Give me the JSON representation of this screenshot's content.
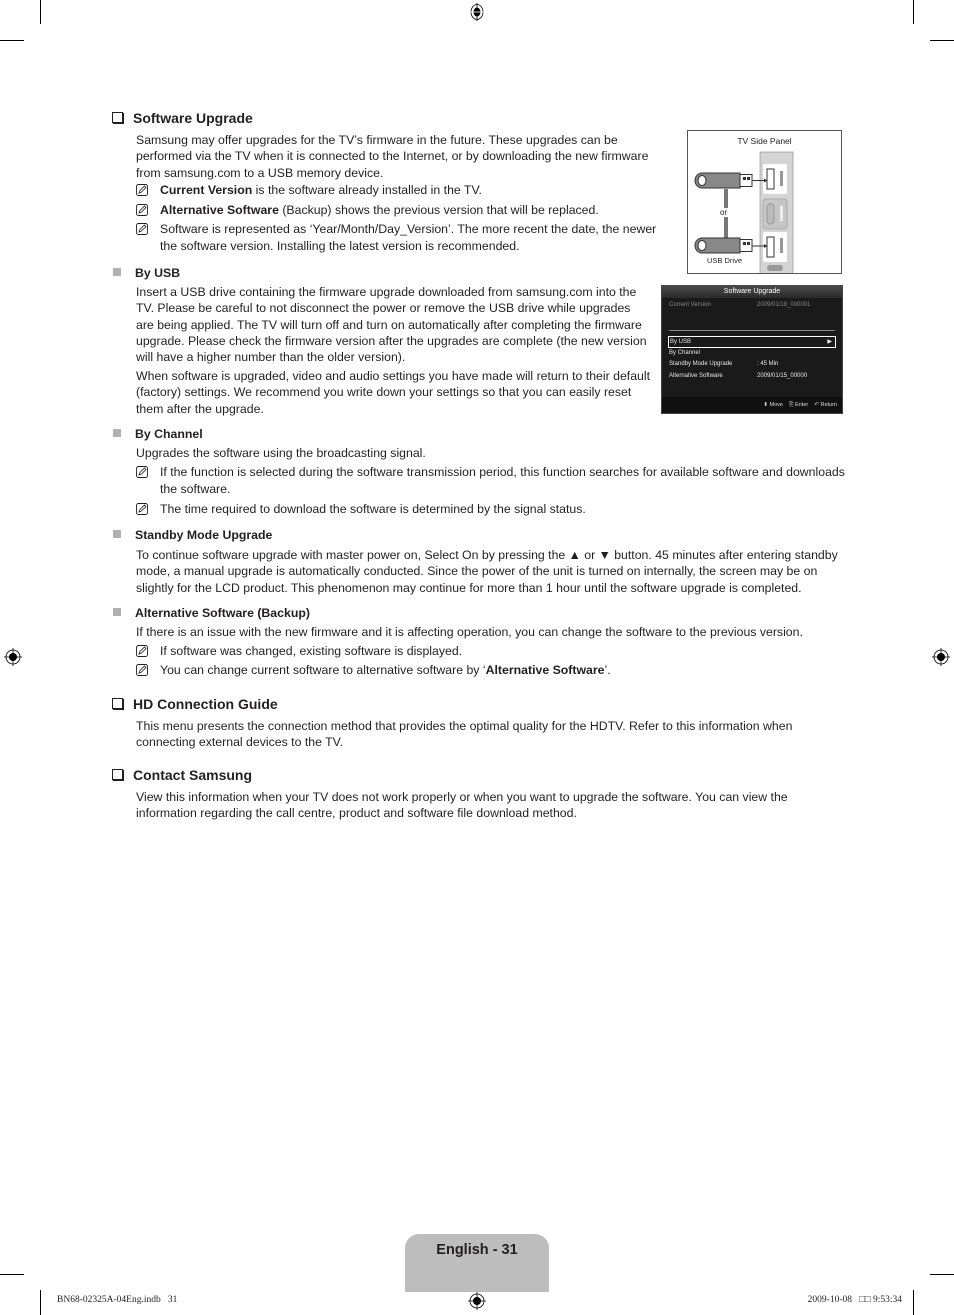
{
  "sections": {
    "software_upgrade": {
      "title": "Software Upgrade",
      "intro": "Samsung may offer upgrades for the TV’s firmware in the future. These upgrades can be performed via the TV when it is connected to the Internet, or by downloading the new firmware from samsung.com to a USB memory device.",
      "notes": [
        {
          "bold": "Current Version",
          "text": " is the software already installed in the TV."
        },
        {
          "bold": "Alternative Software",
          "text": " (Backup) shows the previous version that will be replaced."
        },
        {
          "bold": "",
          "text": "Software is represented as ‘Year/Month/Day_Version’. The more recent the date, the newer the software version. Installing the latest version is recommended."
        }
      ],
      "by_usb": {
        "title": "By USB",
        "p1": "Insert a USB drive containing the firmware upgrade downloaded from samsung.com into the TV. Please be careful to not disconnect the power or remove the USB drive while upgrades are being applied. The TV will turn off and turn on automatically after completing the firmware upgrade. Please check the firmware version after the upgrades are complete (the new version will have a higher number than the older version).",
        "p2": "When software is upgraded, video and audio settings you have made will return to their default (factory) settings. We recommend you write down your settings so that you can easily reset them after the upgrade."
      },
      "by_channel": {
        "title": "By Channel",
        "p1": "Upgrades the software using the broadcasting signal.",
        "notes": [
          "If the function is selected during the software transmission period, this function searches for available software and downloads the software.",
          "The time required to download the software is determined by the signal status."
        ]
      },
      "standby": {
        "title": "Standby Mode Upgrade",
        "p1": "To continue software upgrade with master power on, Select On by pressing the ▲ or ▼ button. 45 minutes after entering standby mode, a manual upgrade is automatically conducted. Since the power of the unit is turned on internally, the screen may be on slightly for the LCD product. This phenomenon may continue for more than 1 hour until the software upgrade is completed."
      },
      "alternative": {
        "title": "Alternative Software (Backup)",
        "p1": "If there is an issue with the new firmware and it is affecting operation, you can change the software to the previous version.",
        "note1": "If software was changed, existing software is displayed.",
        "note2_pre": "You can change current software to alternative software by ‘",
        "note2_bold": "Alternative Software",
        "note2_post": "’."
      }
    },
    "hd_guide": {
      "title": "HD Connection Guide",
      "p1": "This menu presents the connection method that provides the optimal quality for the HDTV. Refer to this information when connecting external devices to the TV."
    },
    "contact": {
      "title": "Contact Samsung",
      "p1": "View this information when your TV does not work properly or when you want to upgrade the software. You can view the information regarding the call centre, product and software file download method."
    }
  },
  "figure_tv_panel": {
    "title": "TV Side Panel",
    "or_label": "or",
    "usb_label": "USB Drive"
  },
  "osd": {
    "title": "Software Upgrade",
    "current_label": "Current Version",
    "current_value": "2009/01/18_000001",
    "items": [
      {
        "label": "By USB",
        "value": "",
        "selected": true
      },
      {
        "label": "By Channel",
        "value": ""
      },
      {
        "label": "Standby Mode Upgrade",
        "value": ": 45 Min"
      },
      {
        "label": "Alternative Software",
        "value": "2009/01/15_00000"
      }
    ],
    "footer": {
      "move": "Move",
      "enter": "Enter",
      "return": "Return"
    }
  },
  "footer": {
    "page_label": "English - 31",
    "file_info": "BN68-02325A-04Eng.indb   31",
    "date_info": "2009-10-08   □□ 9:53:34"
  }
}
